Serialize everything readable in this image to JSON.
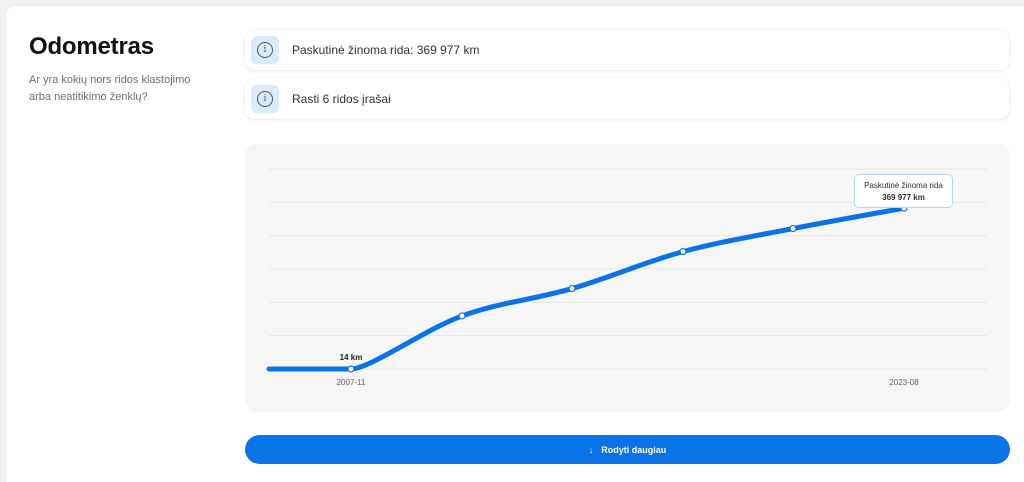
{
  "section": {
    "title": "Odometras",
    "subtitle": "Ar yra kokių nors ridos klastojimo arba neatitikimo ženklų?"
  },
  "info_items": [
    {
      "icon": "info-icon",
      "text": "Paskutinė žinoma rida: 369 977 km"
    },
    {
      "icon": "info-icon",
      "text": "Rasti 6 ridos įrašai"
    }
  ],
  "chart_data": {
    "type": "line",
    "x_tick_labels": [
      "2007-11",
      "2023-08"
    ],
    "points": [
      {
        "x": "2007-11",
        "y": 14
      },
      {
        "x": "p2",
        "y": 122000
      },
      {
        "x": "p3",
        "y": 185000
      },
      {
        "x": "p4",
        "y": 270000
      },
      {
        "x": "p5",
        "y": 323000
      },
      {
        "x": "2023-08",
        "y": 369977
      }
    ],
    "first_point_label": "14 km",
    "tooltip": {
      "title": "Paskutinė žinoma rida",
      "value": "369 977 km"
    },
    "ylim": [
      0,
      460000
    ],
    "grid": true,
    "line_color": "#0a73e8"
  },
  "button": {
    "icon": "arrow-down-icon",
    "label": "Rodyti daugiau"
  }
}
